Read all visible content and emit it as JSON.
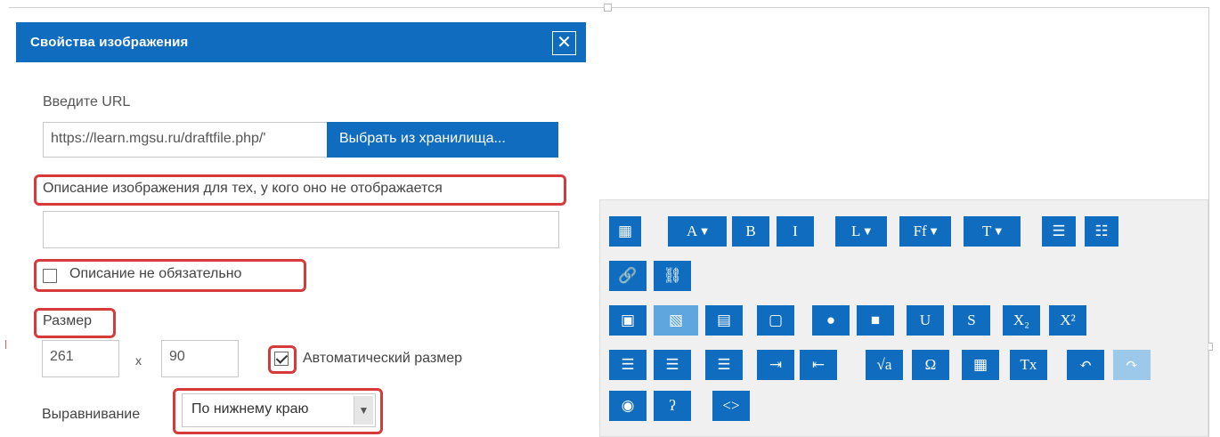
{
  "dialog": {
    "title": "Свойства изображения",
    "close_icon": "close-icon",
    "url_label": "Введите URL",
    "url_value": "https://learn.mgsu.ru/draftfile.php/'",
    "browse_button": "Выбрать из хранилища...",
    "description_label": "Описание изображения для тех, у кого оно не отображается",
    "description_value": "",
    "no_description_label": "Описание не обязательно",
    "no_description_checked": false,
    "size_label": "Размер",
    "width": "261",
    "times": "x",
    "height": "90",
    "auto_size_label": "Автоматический размер",
    "auto_size_checked": true,
    "align_label": "Выравнивание",
    "align_value": "По нижнему краю"
  },
  "toolbar": {
    "rows": [
      [
        {
          "name": "collapse",
          "icon": "collapse-icon",
          "text": "▦"
        },
        {
          "name": "title",
          "icon": "title-icon",
          "text": "A",
          "dropdown": true
        },
        {
          "name": "bold",
          "icon": "bold-icon",
          "text": "B"
        },
        {
          "name": "italic",
          "icon": "italic-icon",
          "text": "I"
        },
        {
          "name": "styles",
          "icon": "styles-icon",
          "text": "L",
          "dropdown": true
        },
        {
          "name": "font-family",
          "icon": "font-family-icon",
          "text": "Ff",
          "dropdown": true
        },
        {
          "name": "font-size",
          "icon": "font-size-icon",
          "text": "T",
          "dropdown": true
        },
        {
          "name": "unordered-list",
          "icon": "unordered-list-icon",
          "text": "☰"
        },
        {
          "name": "ordered-list",
          "icon": "ordered-list-icon",
          "text": "☷"
        }
      ],
      [
        {
          "name": "link",
          "icon": "link-icon",
          "text": "🔗"
        },
        {
          "name": "unlink",
          "icon": "unlink-icon",
          "text": "⛓"
        }
      ],
      [
        {
          "name": "emoticon",
          "icon": "emoticon-icon",
          "text": "▣"
        },
        {
          "name": "image",
          "icon": "image-icon",
          "text": "▧"
        },
        {
          "name": "media",
          "icon": "media-icon",
          "text": "▤"
        },
        {
          "name": "manage-files",
          "icon": "files-icon",
          "text": "▢"
        },
        {
          "name": "record-audio",
          "icon": "microphone-icon",
          "text": "●"
        },
        {
          "name": "record-video",
          "icon": "video-camera-icon",
          "text": "■"
        },
        {
          "name": "underline",
          "icon": "underline-icon",
          "text": "U"
        },
        {
          "name": "strikethrough",
          "icon": "strikethrough-icon",
          "text": "S"
        },
        {
          "name": "subscript",
          "icon": "subscript-icon",
          "text": "X₂"
        },
        {
          "name": "superscript",
          "icon": "superscript-icon",
          "text": "X²"
        }
      ],
      [
        {
          "name": "align-left",
          "icon": "align-left-icon",
          "text": "☰"
        },
        {
          "name": "align-center",
          "icon": "align-center-icon",
          "text": "☰"
        },
        {
          "name": "align-right",
          "icon": "align-right-icon",
          "text": "☰"
        },
        {
          "name": "indent",
          "icon": "indent-icon",
          "text": "⇥"
        },
        {
          "name": "outdent",
          "icon": "outdent-icon",
          "text": "⇤"
        },
        {
          "name": "equation",
          "icon": "equation-icon",
          "text": "√a"
        },
        {
          "name": "special-character",
          "icon": "omega-icon",
          "text": "Ω"
        },
        {
          "name": "table",
          "icon": "table-icon",
          "text": "▦"
        },
        {
          "name": "clear-formatting",
          "icon": "clear-formatting-icon",
          "text": "Tx"
        },
        {
          "name": "undo",
          "icon": "undo-icon",
          "text": "↶"
        },
        {
          "name": "redo",
          "icon": "redo-icon",
          "text": "↷"
        }
      ],
      [
        {
          "name": "accessibility-checker",
          "icon": "eye-slash-icon",
          "text": "◉"
        },
        {
          "name": "screen-reader-helper",
          "icon": "ear-icon",
          "text": "ʔ"
        },
        {
          "name": "html",
          "icon": "code-icon",
          "text": "<>"
        }
      ]
    ]
  },
  "colors": {
    "primary": "#0f6cbf",
    "highlight": "#d63a3a",
    "toolbar_bg": "#f0f0f0"
  }
}
